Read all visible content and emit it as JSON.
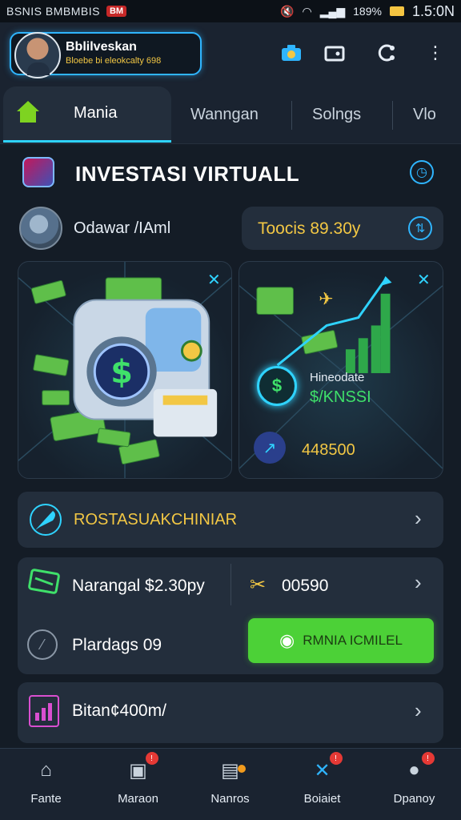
{
  "status_bar": {
    "carrier": "BSNIS BMBMBIS",
    "badge": "BM",
    "battery": "189%",
    "time": "1.5:0N"
  },
  "profile": {
    "name": "Bblilveskan",
    "subtitle": "Bloebe bi eleokcalty 698"
  },
  "header_icons": [
    "camera-icon",
    "wallet-icon",
    "refresh-icon",
    "more-icon"
  ],
  "tabs": [
    {
      "label": "Mania"
    },
    {
      "label": "Wanngan"
    },
    {
      "label": "Solngs"
    },
    {
      "label": "Vlo"
    }
  ],
  "section": {
    "title": "INVESTASI VIRTUALL"
  },
  "account": {
    "name": "Odawar /IAml",
    "value": "Toocis 89.30y"
  },
  "stats_panel": {
    "label": "Hineodate",
    "value": "$/KNSSI",
    "amount": "448500"
  },
  "rows": {
    "promo": "ROSTASUAKCHINIAR",
    "balance": "Narangal $2.30py",
    "balance_side": "00590",
    "pending": "Plardags 09",
    "bonus": "Bitan¢400m/"
  },
  "green_button": {
    "label": "RMNIA ICMILEL"
  },
  "bottom_nav": [
    {
      "label": "Fante"
    },
    {
      "label": "Maraon"
    },
    {
      "label": "Nanros"
    },
    {
      "label": "Boiaiet"
    },
    {
      "label": "Dpanoy"
    }
  ],
  "colors": {
    "accent": "#2fd3ff",
    "gold": "#f2c744",
    "green": "#4cd137",
    "background": "#141c26"
  }
}
